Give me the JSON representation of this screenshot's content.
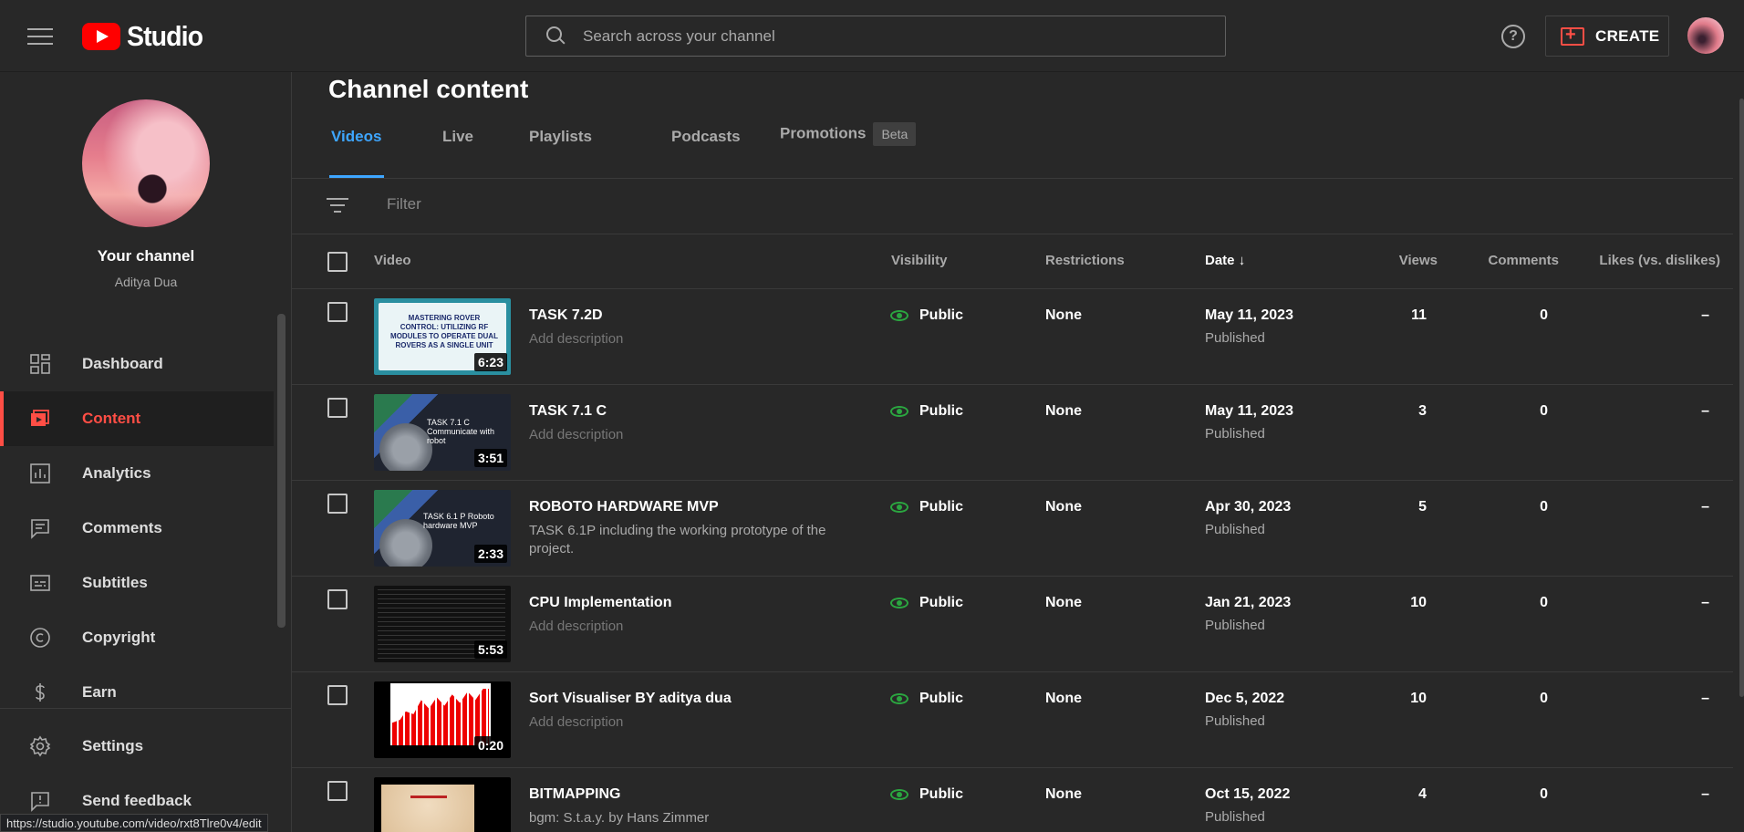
{
  "header": {
    "logo_text": "Studio",
    "search_placeholder": "Search across your channel",
    "help_label": "?",
    "create_label": "CREATE"
  },
  "sidebar": {
    "channel_title": "Your channel",
    "channel_name": "Aditya Dua",
    "items": [
      {
        "label": "Dashboard",
        "icon": "dashboard-icon",
        "active": false
      },
      {
        "label": "Content",
        "icon": "content-icon",
        "active": true
      },
      {
        "label": "Analytics",
        "icon": "analytics-icon",
        "active": false
      },
      {
        "label": "Comments",
        "icon": "comments-icon",
        "active": false
      },
      {
        "label": "Subtitles",
        "icon": "subtitles-icon",
        "active": false
      },
      {
        "label": "Copyright",
        "icon": "copyright-icon",
        "active": false
      },
      {
        "label": "Earn",
        "icon": "earn-icon",
        "active": false
      }
    ],
    "bottom_items": [
      {
        "label": "Settings",
        "icon": "settings-icon"
      },
      {
        "label": "Send feedback",
        "icon": "feedback-icon"
      }
    ]
  },
  "main": {
    "title": "Channel content",
    "tabs": [
      {
        "label": "Videos",
        "active": true
      },
      {
        "label": "Live",
        "active": false
      },
      {
        "label": "Playlists",
        "active": false
      },
      {
        "label": "Podcasts",
        "active": false
      },
      {
        "label": "Promotions",
        "active": false,
        "badge": "Beta"
      }
    ],
    "filter_placeholder": "Filter",
    "columns": {
      "video": "Video",
      "visibility": "Visibility",
      "restrictions": "Restrictions",
      "date": "Date",
      "views": "Views",
      "comments": "Comments",
      "likes": "Likes (vs. dislikes)"
    },
    "rows": [
      {
        "title": "TASK 7.2D",
        "description": "Add description",
        "has_description": false,
        "duration": "6:23",
        "thumb_text": "MASTERING ROVER CONTROL: UTILIZING RF MODULES TO OPERATE DUAL ROVERS AS A SINGLE UNIT",
        "visibility": "Public",
        "restrictions": "None",
        "date": "May 11, 2023",
        "status": "Published",
        "views": "11",
        "comments": "0",
        "likes": "–"
      },
      {
        "title": "TASK 7.1 C",
        "description": "Add description",
        "has_description": false,
        "duration": "3:51",
        "thumb_text": "TASK 7.1 C Communicate with robot",
        "visibility": "Public",
        "restrictions": "None",
        "date": "May 11, 2023",
        "status": "Published",
        "views": "3",
        "comments": "0",
        "likes": "–"
      },
      {
        "title": "ROBOTO HARDWARE MVP",
        "description": "TASK 6.1P including the working prototype of the project.",
        "has_description": true,
        "duration": "2:33",
        "thumb_text": "TASK 6.1 P Roboto hardware MVP",
        "visibility": "Public",
        "restrictions": "None",
        "date": "Apr 30, 2023",
        "status": "Published",
        "views": "5",
        "comments": "0",
        "likes": "–"
      },
      {
        "title": "CPU Implementation",
        "description": "Add description",
        "has_description": false,
        "duration": "5:53",
        "thumb_text": "",
        "visibility": "Public",
        "restrictions": "None",
        "date": "Jan 21, 2023",
        "status": "Published",
        "views": "10",
        "comments": "0",
        "likes": "–"
      },
      {
        "title": "Sort Visualiser BY aditya dua",
        "description": "Add description",
        "has_description": false,
        "duration": "0:20",
        "thumb_text": "",
        "visibility": "Public",
        "restrictions": "None",
        "date": "Dec 5, 2022",
        "status": "Published",
        "views": "10",
        "comments": "0",
        "likes": "–"
      },
      {
        "title": "BITMAPPING",
        "description": "bgm: S.t.a.y. by Hans Zimmer",
        "has_description": true,
        "duration": "",
        "thumb_text": "",
        "visibility": "Public",
        "restrictions": "None",
        "date": "Oct 15, 2022",
        "status": "Published",
        "views": "4",
        "comments": "0",
        "likes": "–"
      }
    ]
  },
  "status_bar": {
    "url": "https://studio.youtube.com/video/rxt8Tlre0v4/edit"
  },
  "colors": {
    "accent_blue": "#3ea6ff",
    "active_red": "#ff4e45",
    "public_green": "#2ba640",
    "brand_red": "#ff0000",
    "background": "#282828"
  }
}
